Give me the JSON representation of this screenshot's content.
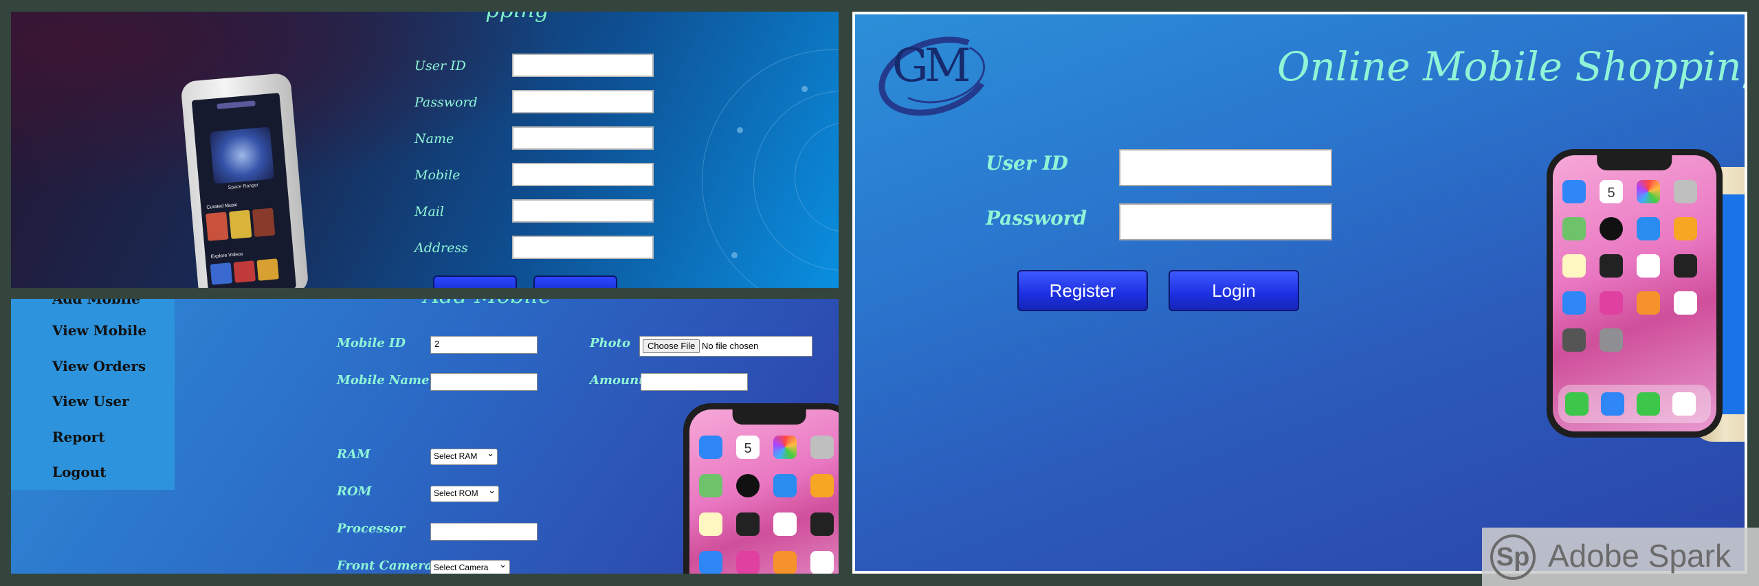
{
  "registration": {
    "title_clip": "pping",
    "fields": [
      {
        "label": "User ID"
      },
      {
        "label": "Password"
      },
      {
        "label": "Name"
      },
      {
        "label": "Mobile"
      },
      {
        "label": "Mail"
      },
      {
        "label": "Address"
      }
    ],
    "phone_screen": {
      "app_name": "Space Ranger",
      "section_1": "Curated Music",
      "section_2": "Explore Videos"
    }
  },
  "add_mobile": {
    "title_clip": "Add Mobile",
    "menu": {
      "items": [
        {
          "label": "Add Mobile"
        },
        {
          "label": "View Mobile"
        },
        {
          "label": "View Orders"
        },
        {
          "label": "View User"
        },
        {
          "label": "Report"
        },
        {
          "label": "Logout"
        }
      ]
    },
    "form": {
      "mobile_id_label": "Mobile ID",
      "mobile_id_value": "2",
      "mobile_name_label": "Mobile Name",
      "mobile_name_value": "",
      "photo_label": "Photo",
      "photo_button": "Choose File",
      "photo_status": "No file chosen",
      "amount_label": "Amount",
      "amount_value": "",
      "ram_label": "RAM",
      "ram_selected": "Select RAM",
      "rom_label": "ROM",
      "rom_selected": "Select ROM",
      "processor_label": "Processor",
      "processor_value": "",
      "front_camera_label": "Front Camera",
      "front_camera_selected": "Select Camera"
    },
    "phone": {
      "calendar_day": "5"
    }
  },
  "login": {
    "site_title": "Online Mobile Shopping",
    "logo_text": "GM",
    "user_id_label": "User ID",
    "user_id_value": "",
    "password_label": "Password",
    "password_value": "",
    "register_button": "Register",
    "login_button": "Login",
    "phone": {
      "calendar_day": "5"
    }
  },
  "watermark": {
    "text": "Adobe Spark",
    "logo": "Sp"
  }
}
